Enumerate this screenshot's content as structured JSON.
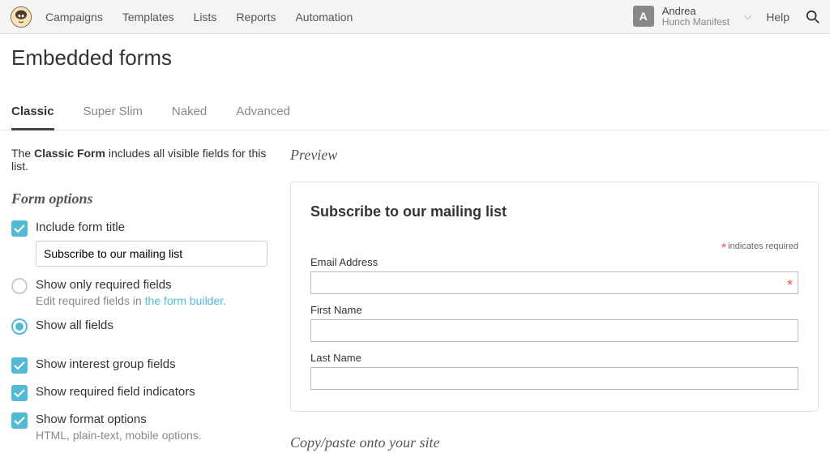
{
  "nav": {
    "items": [
      "Campaigns",
      "Templates",
      "Lists",
      "Reports",
      "Automation"
    ],
    "account_initial": "A",
    "account_name": "Andrea",
    "account_org": "Hunch Manifest",
    "help": "Help"
  },
  "page": {
    "title": "Embedded forms"
  },
  "tabs": [
    "Classic",
    "Super Slim",
    "Naked",
    "Advanced"
  ],
  "desc": {
    "prefix": "The ",
    "bold": "Classic Form",
    "suffix": " includes all visible fields for this list."
  },
  "options_heading": "Form options",
  "options": {
    "include_title_label": "Include form title",
    "title_value": "Subscribe to our mailing list",
    "required_only_label": "Show only required fields",
    "required_only_sub_prefix": "Edit required fields in ",
    "required_only_sub_link": "the form builder",
    "show_all_label": "Show all fields",
    "interest_label": "Show interest group fields",
    "indicators_label": "Show required field indicators",
    "format_label": "Show format options",
    "format_sub": "HTML, plain-text, mobile options."
  },
  "preview": {
    "heading": "Preview",
    "form_title": "Subscribe to our mailing list",
    "required_note": "indicates required",
    "fields": {
      "email": "Email Address",
      "first_name": "First Name",
      "last_name": "Last Name"
    },
    "copy_heading": "Copy/paste onto your site"
  }
}
